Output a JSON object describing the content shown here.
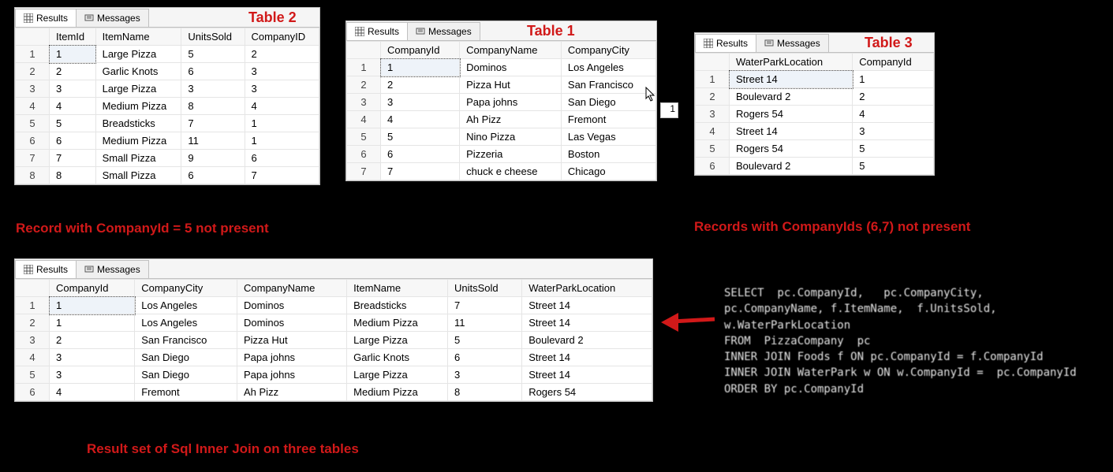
{
  "tabs": {
    "results": "Results",
    "messages": "Messages"
  },
  "labels": {
    "table1": "Table 1",
    "table2": "Table 2",
    "table3": "Table 3",
    "note2": "Record with CompanyId = 5 not present",
    "note3": "Records with CompanyIds (6,7) not present",
    "result": "Result set of Sql Inner Join on three tables"
  },
  "panel2": {
    "headers": [
      "ItemId",
      "ItemName",
      "UnitsSold",
      "CompanyID"
    ],
    "rows": [
      [
        "1",
        "Large Pizza",
        "5",
        "2"
      ],
      [
        "2",
        "Garlic Knots",
        "6",
        "3"
      ],
      [
        "3",
        "Large Pizza",
        "3",
        "3"
      ],
      [
        "4",
        "Medium Pizza",
        "8",
        "4"
      ],
      [
        "5",
        "Breadsticks",
        "7",
        "1"
      ],
      [
        "6",
        "Medium Pizza",
        "11",
        "1"
      ],
      [
        "7",
        "Small Pizza",
        "9",
        "6"
      ],
      [
        "8",
        "Small Pizza",
        "6",
        "7"
      ]
    ]
  },
  "panel1": {
    "headers": [
      "CompanyId",
      "CompanyName",
      "CompanyCity"
    ],
    "rows": [
      [
        "1",
        "Dominos",
        "Los Angeles"
      ],
      [
        "2",
        "Pizza Hut",
        "San Francisco"
      ],
      [
        "3",
        "Papa johns",
        "San Diego"
      ],
      [
        "4",
        "Ah Pizz",
        "Fremont"
      ],
      [
        "5",
        "Nino Pizza",
        "Las Vegas"
      ],
      [
        "6",
        "Pizzeria",
        "Boston"
      ],
      [
        "7",
        "chuck e cheese",
        "Chicago"
      ]
    ]
  },
  "panel3": {
    "headers": [
      "WaterParkLocation",
      "CompanyId"
    ],
    "rows": [
      [
        "Street 14",
        "1"
      ],
      [
        "Boulevard 2",
        "2"
      ],
      [
        "Rogers 54",
        "4"
      ],
      [
        "Street 14",
        "3"
      ],
      [
        "Rogers 54",
        "5"
      ],
      [
        "Boulevard 2",
        "5"
      ]
    ]
  },
  "panelResult": {
    "headers": [
      "CompanyId",
      "CompanyCity",
      "CompanyName",
      "ItemName",
      "UnitsSold",
      "WaterParkLocation"
    ],
    "rows": [
      [
        "1",
        "Los Angeles",
        "Dominos",
        "Breadsticks",
        "7",
        "Street 14"
      ],
      [
        "1",
        "Los Angeles",
        "Dominos",
        "Medium Pizza",
        "11",
        "Street 14"
      ],
      [
        "2",
        "San Francisco",
        "Pizza Hut",
        "Large Pizza",
        "5",
        "Boulevard 2"
      ],
      [
        "3",
        "San Diego",
        "Papa johns",
        "Garlic Knots",
        "6",
        "Street 14"
      ],
      [
        "3",
        "San Diego",
        "Papa johns",
        "Large Pizza",
        "3",
        "Street 14"
      ],
      [
        "4",
        "Fremont",
        "Ah Pizz",
        "Medium Pizza",
        "8",
        "Rogers 54"
      ]
    ]
  },
  "sql": "SELECT  pc.CompanyId,   pc.CompanyCity,\npc.CompanyName, f.ItemName,  f.UnitsSold,\nw.WaterParkLocation\nFROM  PizzaCompany  pc\nINNER JOIN Foods f ON pc.CompanyId = f.CompanyId\nINNER JOIN WaterPark w ON w.CompanyId =  pc.CompanyId\nORDER BY pc.CompanyId"
}
